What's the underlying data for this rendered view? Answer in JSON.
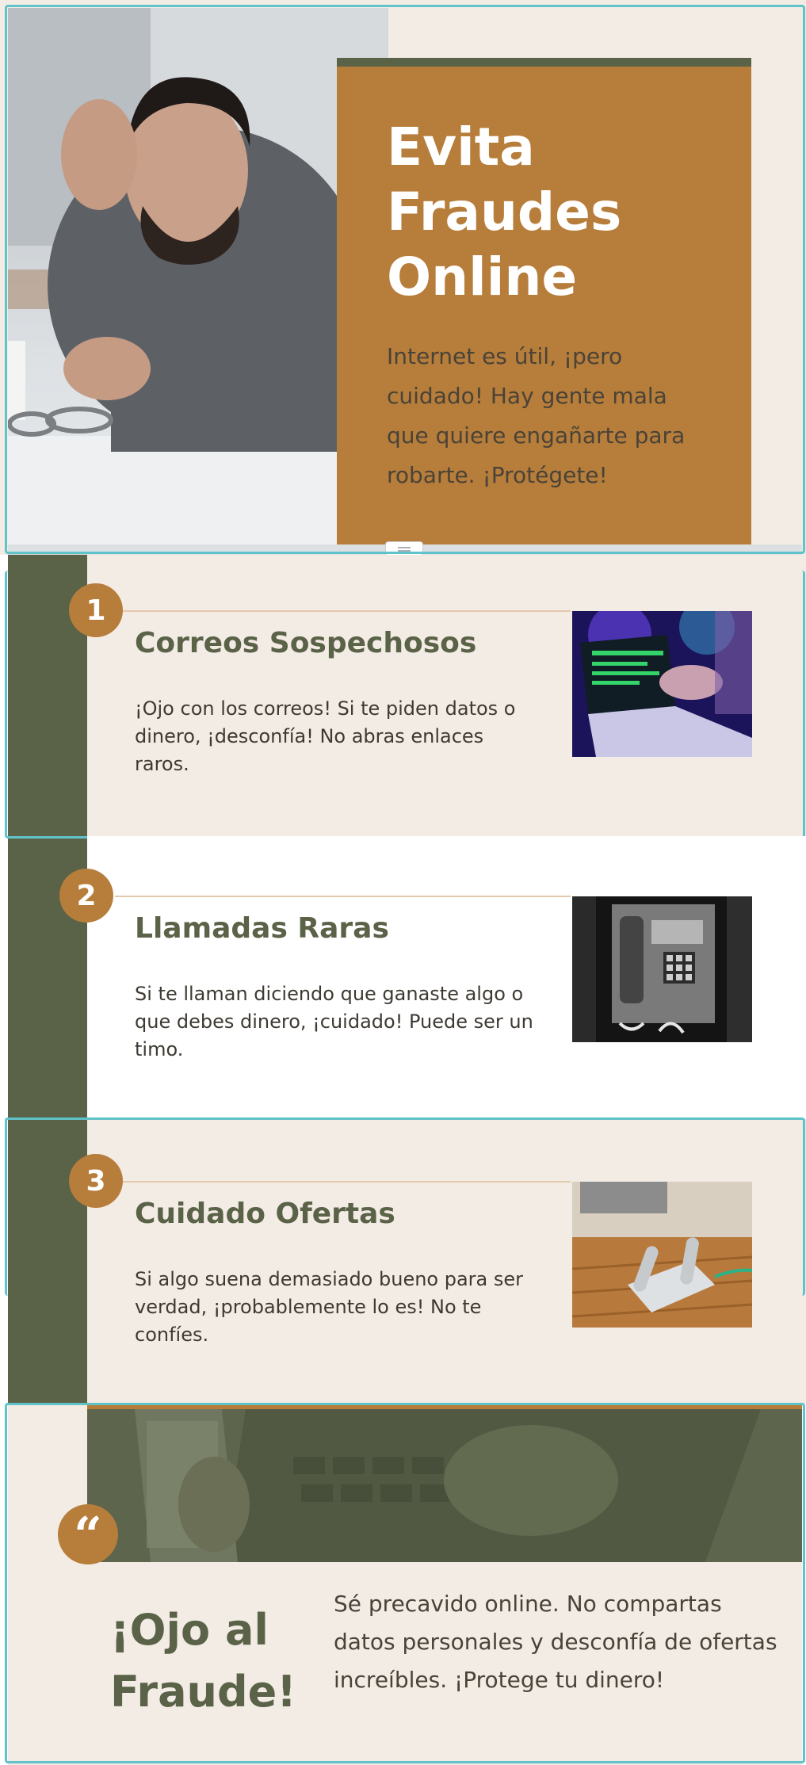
{
  "hero": {
    "title": "Evita\nFraudes\nOnline",
    "text": "Internet es útil, ¡pero cuidado! Hay gente mala que quiere engañarte para robarte. ¡Protégete!"
  },
  "steps": [
    {
      "number": "1",
      "title": "Correos Sospechosos",
      "text": "¡Ojo con los correos! Si te piden datos o dinero, ¡desconfía! No abras enlaces raros."
    },
    {
      "number": "2",
      "title": "Llamadas Raras",
      "text": "Si te llaman diciendo que ganaste algo o que debes dinero, ¡cuidado! Puede ser un timo."
    },
    {
      "number": "3",
      "title": "Cuidado Ofertas",
      "text": "Si algo suena demasiado bueno para ser verdad, ¡probablemente lo es! No te confíes."
    }
  ],
  "quote": {
    "mark": "“",
    "title": "¡Ojo al Fraude!",
    "text": "Sé precavido online. No compartas datos personales y desconfía de ofertas increíbles. ¡Protege tu dinero!"
  },
  "colors": {
    "accent": "#b77d3a",
    "dark_green": "#5a6248",
    "background": "#f3ece5",
    "selection": "#5fc3c9"
  }
}
